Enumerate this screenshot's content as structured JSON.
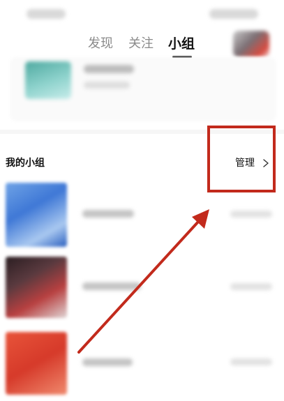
{
  "top_tabs": {
    "discover": "发现",
    "follow": "关注",
    "groups": "小组",
    "active_tab": "小组"
  },
  "my_groups": {
    "title": "我的小组",
    "manage_label": "管理",
    "manage_icon": "chevron-right-icon"
  },
  "annotation": {
    "color": "#c22a1c"
  }
}
